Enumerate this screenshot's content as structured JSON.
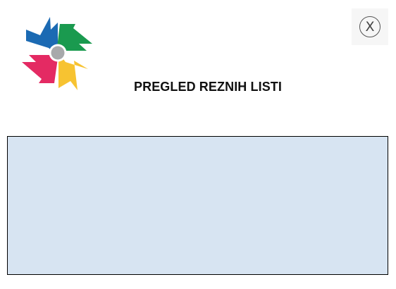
{
  "header": {
    "title": "PREGLED REZNIH LISTI",
    "logo_icon": "pinwheel-logo-icon",
    "close_label": "X",
    "close_icon": "close-icon"
  },
  "colors": {
    "logo_blue": "#1b6ab3",
    "logo_green": "#1a9a4f",
    "logo_yellow": "#f7c331",
    "logo_pink": "#e42a63",
    "logo_center": "#a7a9ab",
    "panel_background": "#d7e4f2",
    "panel_border": "#000000"
  }
}
